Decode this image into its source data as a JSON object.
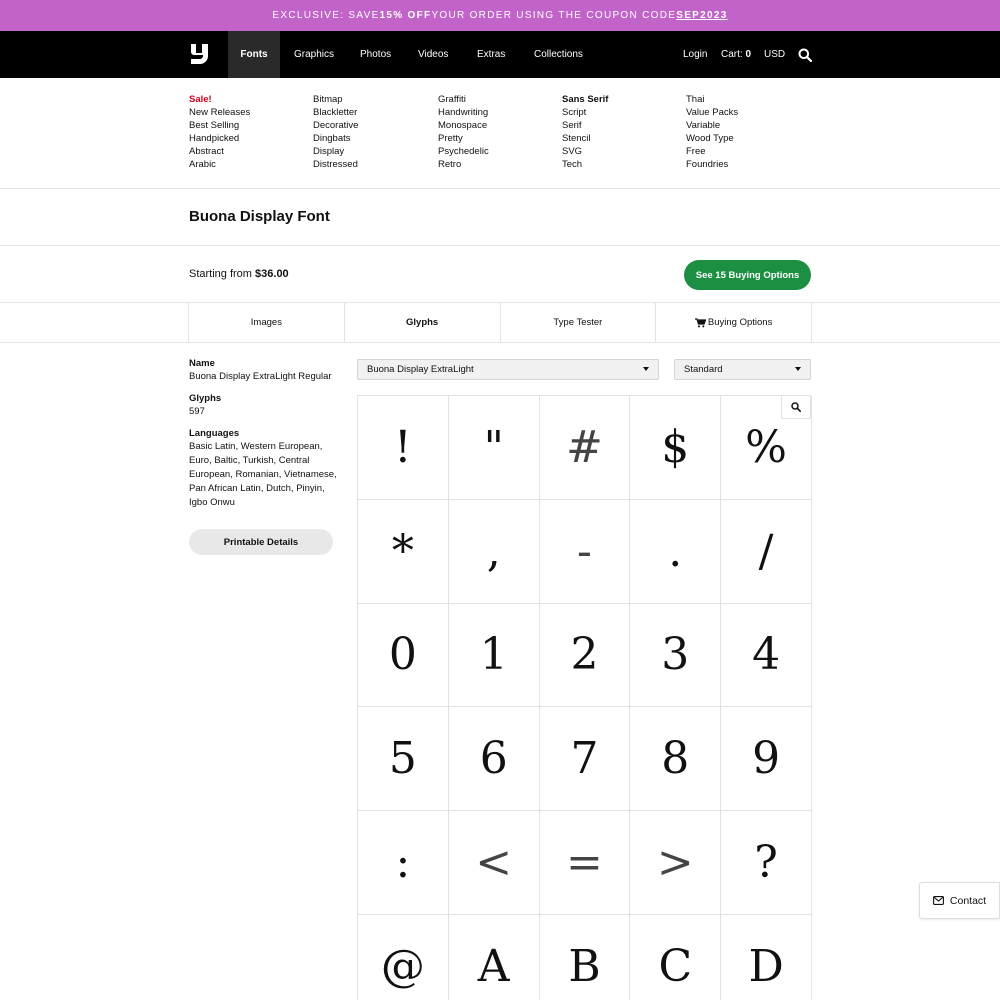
{
  "promo": {
    "prefix": "EXCLUSIVE: SAVE ",
    "highlight": "15% OFF",
    "middle": " YOUR ORDER USING THE COUPON CODE ",
    "code": "SEP2023"
  },
  "nav": {
    "items": [
      "Fonts",
      "Graphics",
      "Photos",
      "Videos",
      "Extras",
      "Collections"
    ],
    "login": "Login",
    "cart_label": "Cart:",
    "cart_count": "0",
    "currency": "USD"
  },
  "mega_menu": {
    "columns": [
      [
        "Sale!",
        "New Releases",
        "Best Selling",
        "Handpicked",
        "Abstract",
        "Arabic"
      ],
      [
        "Bitmap",
        "Blackletter",
        "Decorative",
        "Dingbats",
        "Display",
        "Distressed"
      ],
      [
        "Graffiti",
        "Handwriting",
        "Monospace",
        "Pretty",
        "Psychedelic",
        "Retro"
      ],
      [
        "Sans Serif",
        "Script",
        "Serif",
        "Stencil",
        "SVG",
        "Tech"
      ],
      [
        "Thai",
        "Value Packs",
        "Variable",
        "Wood Type",
        "Free",
        "Foundries"
      ]
    ]
  },
  "product": {
    "title": "Buona Display Font",
    "price_prefix": "Starting from ",
    "price": "$36.00",
    "buy_button": "See 15 Buying Options"
  },
  "tabs": [
    "Images",
    "Glyphs",
    "Type Tester",
    "Buying Options"
  ],
  "details": {
    "name_label": "Name",
    "name_value": "Buona Display ExtraLight Regular",
    "glyphs_label": "Glyphs",
    "glyphs_value": "597",
    "languages_label": "Languages",
    "languages_value": "Basic Latin, Western European, Euro, Baltic, Turkish, Central European, Romanian, Vietnamese, Pan African Latin, Dutch, Pinyin, Igbo Onwu",
    "print_button": "Printable Details"
  },
  "selects": {
    "style": "Buona Display ExtraLight",
    "set": "Standard"
  },
  "glyphs": [
    "!",
    "\"",
    "#",
    "$",
    "%",
    "*",
    ",",
    "-",
    ".",
    "/",
    "0",
    "1",
    "2",
    "3",
    "4",
    "5",
    "6",
    "7",
    "8",
    "9",
    ":",
    "<",
    "=",
    ">",
    "?",
    "@",
    "A",
    "B",
    "C",
    "D"
  ],
  "contact": "Contact",
  "colors": {
    "promo_bg": "#c263c9",
    "nav_bg": "#000000",
    "buy_button": "#1c8f43",
    "sale": "#d0021b"
  }
}
